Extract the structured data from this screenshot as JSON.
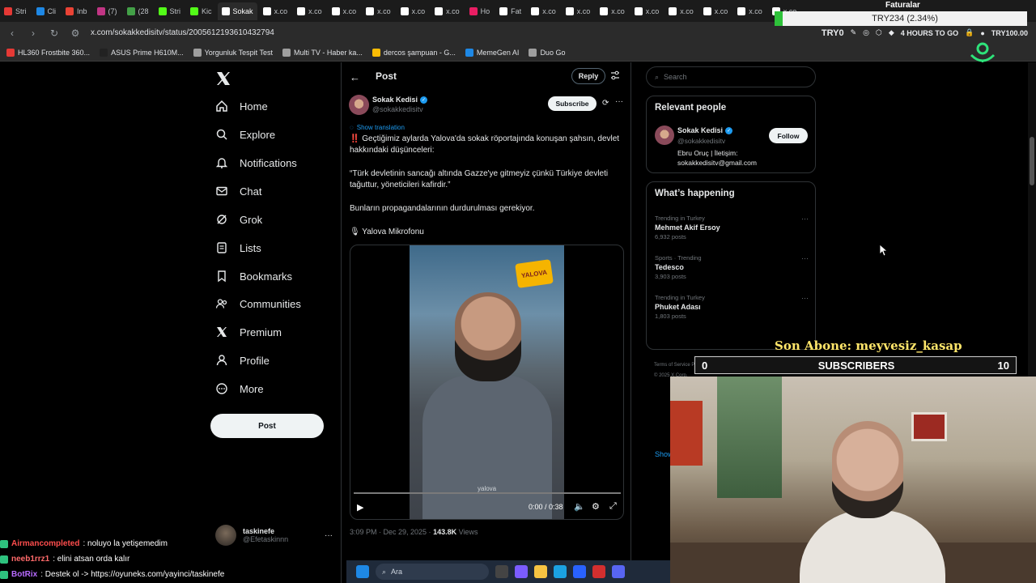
{
  "browser": {
    "tabs": [
      {
        "label": "Stri",
        "color": "#e53935"
      },
      {
        "label": "Cli",
        "color": "#1e88e5"
      },
      {
        "label": "Inb",
        "color": "#ea4335"
      },
      {
        "label": "(7)",
        "color": "#c13584"
      },
      {
        "label": "(28",
        "color": "#43a047"
      },
      {
        "label": "Stri",
        "color": "#53fc18"
      },
      {
        "label": "Kic",
        "color": "#53fc18"
      },
      {
        "label": "Sokak",
        "color": "#ffffff",
        "active": true
      },
      {
        "label": "x.co",
        "color": "#ffffff"
      },
      {
        "label": "x.co",
        "color": "#ffffff"
      },
      {
        "label": "x.co",
        "color": "#ffffff"
      },
      {
        "label": "x.co",
        "color": "#ffffff"
      },
      {
        "label": "x.co",
        "color": "#ffffff"
      },
      {
        "label": "x.co",
        "color": "#ffffff"
      },
      {
        "label": "Ho",
        "color": "#e91e63"
      },
      {
        "label": "Fat",
        "color": "#ffffff"
      },
      {
        "label": "x.co",
        "color": "#ffffff"
      },
      {
        "label": "x.co",
        "color": "#ffffff"
      },
      {
        "label": "x.co",
        "color": "#ffffff"
      },
      {
        "label": "x.co",
        "color": "#ffffff"
      },
      {
        "label": "x.co",
        "color": "#ffffff"
      },
      {
        "label": "x.co",
        "color": "#ffffff"
      },
      {
        "label": "x.co",
        "color": "#ffffff"
      },
      {
        "label": "x.co",
        "color": "#ffffff"
      }
    ],
    "url": "x.com/sokakkedisitv/status/2005612193610432794",
    "tray_label": "TRY0",
    "tray_timer": "4 HOURS TO GO",
    "tray_balance": "TRY100.00",
    "bookmarks": [
      {
        "label": "HL360 Frostbite 360...",
        "color": "#e53935"
      },
      {
        "label": "ASUS Prime H610M...",
        "color": "#222222"
      },
      {
        "label": "Yorgunluk Tespit Test",
        "color": "#9e9e9e"
      },
      {
        "label": "Multi TV - Haber ka...",
        "color": "#9e9e9e"
      },
      {
        "label": "dercos şampuan - G...",
        "color": "#fbbc05"
      },
      {
        "label": "MemeGen AI",
        "color": "#1e88e5"
      },
      {
        "label": "Duo Go",
        "color": "#9e9e9e"
      }
    ]
  },
  "overlay": {
    "faturalar": "Faturalar",
    "currency": "TRY234 (2.34%)",
    "son_abone": "Son Abone: meyvesiz_kasap",
    "sub_min": "0",
    "sub_label": "SUBSCRIBERS",
    "sub_max": "10",
    "sub_progress": 0.0
  },
  "sidebar": {
    "items": [
      {
        "label": "Home",
        "icon": "home-icon"
      },
      {
        "label": "Explore",
        "icon": "search-icon"
      },
      {
        "label": "Notifications",
        "icon": "bell-icon"
      },
      {
        "label": "Chat",
        "icon": "mail-icon"
      },
      {
        "label": "Grok",
        "icon": "grok-icon"
      },
      {
        "label": "Lists",
        "icon": "list-icon"
      },
      {
        "label": "Bookmarks",
        "icon": "bookmark-icon"
      },
      {
        "label": "Communities",
        "icon": "people-icon"
      },
      {
        "label": "Premium",
        "icon": "x-icon"
      },
      {
        "label": "Profile",
        "icon": "person-icon"
      },
      {
        "label": "More",
        "icon": "more-circle-icon"
      }
    ],
    "post_label": "Post",
    "account": {
      "name": "taskinefe",
      "handle": "@Efetaskinnn"
    }
  },
  "post": {
    "header_title": "Post",
    "reply_label": "Reply",
    "author_name": "Sokak Kedisi",
    "author_handle": "@sokakkedisitv",
    "subscribe_label": "Subscribe",
    "translate_label": "Show translation",
    "line1": "Geçtiğimiz aylarda Yalova'da sokak röportajında konuşan şahsın, devlet hakkındaki düşünceleri:",
    "line1_prefix": "‼️",
    "quote": "“Türk devletinin sancağı altında Gazze'ye gitmeyiz çünkü Türkiye devleti tağuttur, yöneticileri kafirdir.”",
    "line3": "Bunların propagandalarının durdurulması gerekiyor.",
    "source": "🎙 Yalova Mikrofonu",
    "video_badge": "YALOVA",
    "video_watermark": "yalova",
    "video_time": "0:00 / 0:38",
    "timestamp": "3:09 PM · Dec 29, 2025 · ",
    "views_count": "143.8K",
    "views_label": " Views"
  },
  "right": {
    "search_placeholder": "Search",
    "relevant_title": "Relevant people",
    "rp_name": "Sokak Kedisi",
    "rp_handle": "@sokakkedisitv",
    "rp_bio": "Ebru Oruç | İletişim: sokakkedisitv@gmail.com",
    "follow_label": "Follow",
    "happening_title": "What’s happening",
    "trends": [
      {
        "context": "Trending in Turkey",
        "name": "Mehmet Akif Ersoy",
        "count": "6,932 posts"
      },
      {
        "context": "Sports · Trending",
        "name": "Tedesco",
        "count": "3,903 posts"
      },
      {
        "context": "Trending in Turkey",
        "name": "Phuket Adası",
        "count": "1,803 posts"
      }
    ],
    "show_more": "Show more",
    "footer": "Terms of Service  Privacy Policy  Cookie Policy  Imprint  Accessibility  Ads info  © 2025 X Corp."
  },
  "chat": [
    {
      "user": "Airmancompleted",
      "msg": " : noluyo la yetişemedim",
      "cls": "u1"
    },
    {
      "user": "neeb1rrz1",
      "msg": " : elini atsan orda kalır",
      "cls": "u2"
    },
    {
      "user": "BotRix",
      "msg": " : Destek ol -> https://oyuneks.com/yayinci/taskinefe",
      "cls": "u3"
    }
  ],
  "taskbar": {
    "search_label": "Ara"
  }
}
